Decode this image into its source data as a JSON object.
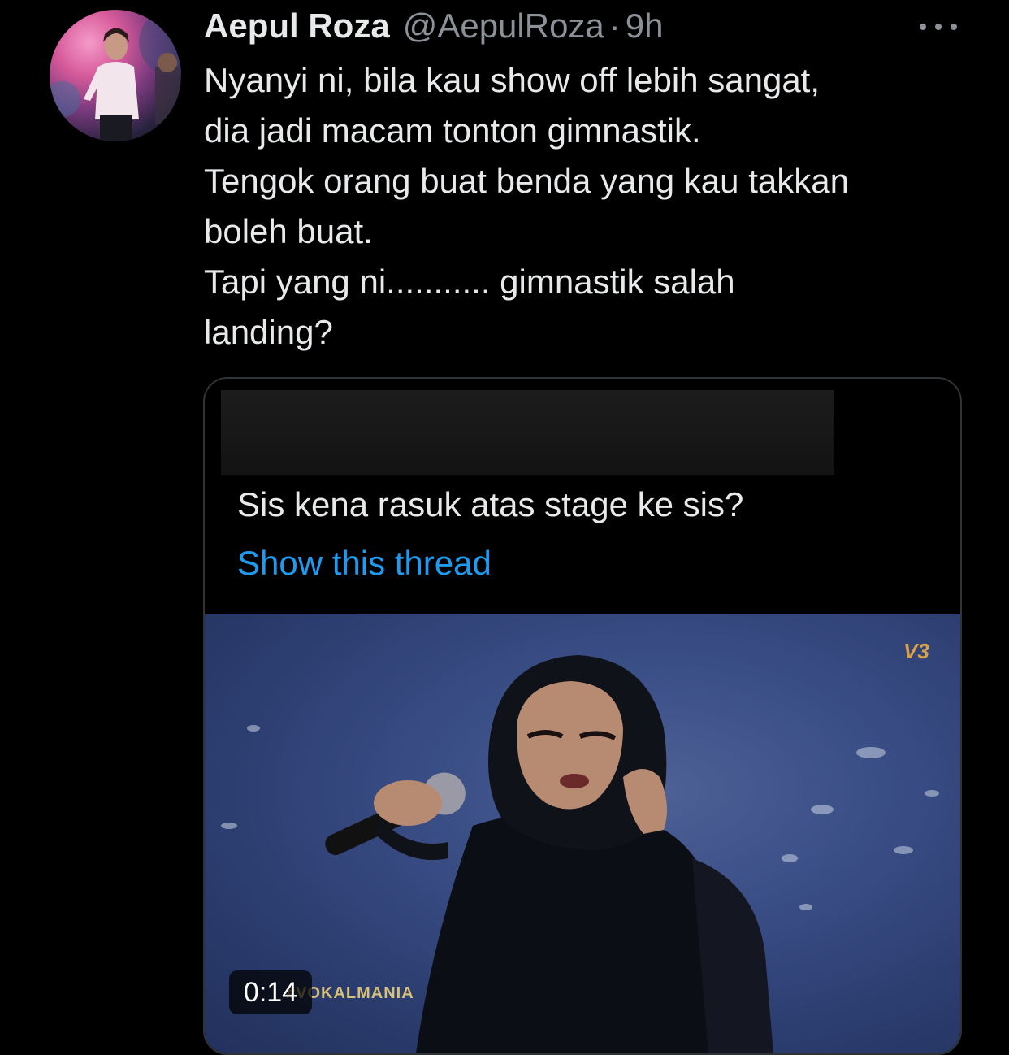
{
  "tweet": {
    "author": {
      "display_name": "Aepul Roza",
      "handle": "@AepulRoza",
      "separator": "·",
      "time": "9h"
    },
    "text_lines": [
      "Nyanyi ni, bila kau show off lebih sangat,",
      "dia jadi macam tonton gimnastik.",
      "Tengok orang buat benda yang kau takkan",
      "boleh buat.",
      "Tapi yang ni........... gimnastik salah",
      "landing?"
    ]
  },
  "quote": {
    "text": "Sis kena rasuk atas stage ke sis?",
    "thread_link": "Show this thread"
  },
  "video": {
    "duration": "0:14",
    "channel_logo": "V3",
    "show_logo": "#VOKALMANIA"
  },
  "icons": {
    "more": "more-options-icon",
    "avatar": "profile-avatar"
  },
  "colors": {
    "background": "#000000",
    "text": "#e7e9ea",
    "secondary_text": "#8b9197",
    "link": "#1d9bf0",
    "border": "#2f3336"
  }
}
